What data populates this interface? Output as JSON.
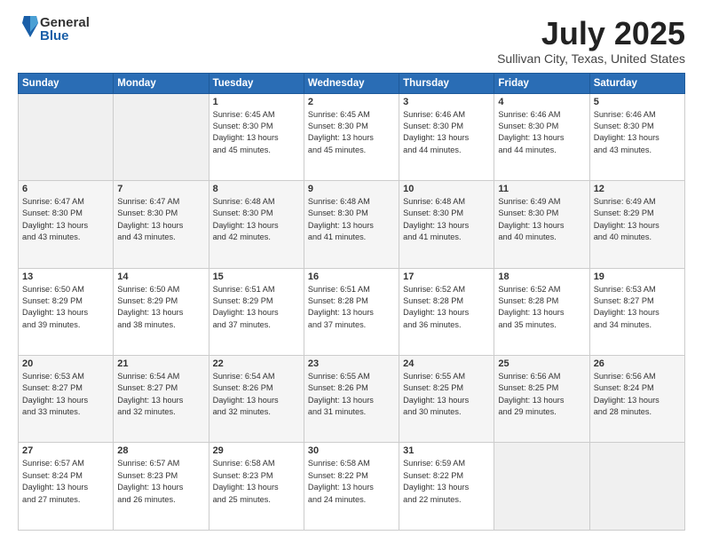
{
  "header": {
    "logo_general": "General",
    "logo_blue": "Blue",
    "title": "July 2025",
    "location": "Sullivan City, Texas, United States"
  },
  "days_of_week": [
    "Sunday",
    "Monday",
    "Tuesday",
    "Wednesday",
    "Thursday",
    "Friday",
    "Saturday"
  ],
  "weeks": [
    [
      {
        "day": "",
        "info": ""
      },
      {
        "day": "",
        "info": ""
      },
      {
        "day": "1",
        "info": "Sunrise: 6:45 AM\nSunset: 8:30 PM\nDaylight: 13 hours\nand 45 minutes."
      },
      {
        "day": "2",
        "info": "Sunrise: 6:45 AM\nSunset: 8:30 PM\nDaylight: 13 hours\nand 45 minutes."
      },
      {
        "day": "3",
        "info": "Sunrise: 6:46 AM\nSunset: 8:30 PM\nDaylight: 13 hours\nand 44 minutes."
      },
      {
        "day": "4",
        "info": "Sunrise: 6:46 AM\nSunset: 8:30 PM\nDaylight: 13 hours\nand 44 minutes."
      },
      {
        "day": "5",
        "info": "Sunrise: 6:46 AM\nSunset: 8:30 PM\nDaylight: 13 hours\nand 43 minutes."
      }
    ],
    [
      {
        "day": "6",
        "info": "Sunrise: 6:47 AM\nSunset: 8:30 PM\nDaylight: 13 hours\nand 43 minutes."
      },
      {
        "day": "7",
        "info": "Sunrise: 6:47 AM\nSunset: 8:30 PM\nDaylight: 13 hours\nand 43 minutes."
      },
      {
        "day": "8",
        "info": "Sunrise: 6:48 AM\nSunset: 8:30 PM\nDaylight: 13 hours\nand 42 minutes."
      },
      {
        "day": "9",
        "info": "Sunrise: 6:48 AM\nSunset: 8:30 PM\nDaylight: 13 hours\nand 41 minutes."
      },
      {
        "day": "10",
        "info": "Sunrise: 6:48 AM\nSunset: 8:30 PM\nDaylight: 13 hours\nand 41 minutes."
      },
      {
        "day": "11",
        "info": "Sunrise: 6:49 AM\nSunset: 8:30 PM\nDaylight: 13 hours\nand 40 minutes."
      },
      {
        "day": "12",
        "info": "Sunrise: 6:49 AM\nSunset: 8:29 PM\nDaylight: 13 hours\nand 40 minutes."
      }
    ],
    [
      {
        "day": "13",
        "info": "Sunrise: 6:50 AM\nSunset: 8:29 PM\nDaylight: 13 hours\nand 39 minutes."
      },
      {
        "day": "14",
        "info": "Sunrise: 6:50 AM\nSunset: 8:29 PM\nDaylight: 13 hours\nand 38 minutes."
      },
      {
        "day": "15",
        "info": "Sunrise: 6:51 AM\nSunset: 8:29 PM\nDaylight: 13 hours\nand 37 minutes."
      },
      {
        "day": "16",
        "info": "Sunrise: 6:51 AM\nSunset: 8:28 PM\nDaylight: 13 hours\nand 37 minutes."
      },
      {
        "day": "17",
        "info": "Sunrise: 6:52 AM\nSunset: 8:28 PM\nDaylight: 13 hours\nand 36 minutes."
      },
      {
        "day": "18",
        "info": "Sunrise: 6:52 AM\nSunset: 8:28 PM\nDaylight: 13 hours\nand 35 minutes."
      },
      {
        "day": "19",
        "info": "Sunrise: 6:53 AM\nSunset: 8:27 PM\nDaylight: 13 hours\nand 34 minutes."
      }
    ],
    [
      {
        "day": "20",
        "info": "Sunrise: 6:53 AM\nSunset: 8:27 PM\nDaylight: 13 hours\nand 33 minutes."
      },
      {
        "day": "21",
        "info": "Sunrise: 6:54 AM\nSunset: 8:27 PM\nDaylight: 13 hours\nand 32 minutes."
      },
      {
        "day": "22",
        "info": "Sunrise: 6:54 AM\nSunset: 8:26 PM\nDaylight: 13 hours\nand 32 minutes."
      },
      {
        "day": "23",
        "info": "Sunrise: 6:55 AM\nSunset: 8:26 PM\nDaylight: 13 hours\nand 31 minutes."
      },
      {
        "day": "24",
        "info": "Sunrise: 6:55 AM\nSunset: 8:25 PM\nDaylight: 13 hours\nand 30 minutes."
      },
      {
        "day": "25",
        "info": "Sunrise: 6:56 AM\nSunset: 8:25 PM\nDaylight: 13 hours\nand 29 minutes."
      },
      {
        "day": "26",
        "info": "Sunrise: 6:56 AM\nSunset: 8:24 PM\nDaylight: 13 hours\nand 28 minutes."
      }
    ],
    [
      {
        "day": "27",
        "info": "Sunrise: 6:57 AM\nSunset: 8:24 PM\nDaylight: 13 hours\nand 27 minutes."
      },
      {
        "day": "28",
        "info": "Sunrise: 6:57 AM\nSunset: 8:23 PM\nDaylight: 13 hours\nand 26 minutes."
      },
      {
        "day": "29",
        "info": "Sunrise: 6:58 AM\nSunset: 8:23 PM\nDaylight: 13 hours\nand 25 minutes."
      },
      {
        "day": "30",
        "info": "Sunrise: 6:58 AM\nSunset: 8:22 PM\nDaylight: 13 hours\nand 24 minutes."
      },
      {
        "day": "31",
        "info": "Sunrise: 6:59 AM\nSunset: 8:22 PM\nDaylight: 13 hours\nand 22 minutes."
      },
      {
        "day": "",
        "info": ""
      },
      {
        "day": "",
        "info": ""
      }
    ]
  ]
}
